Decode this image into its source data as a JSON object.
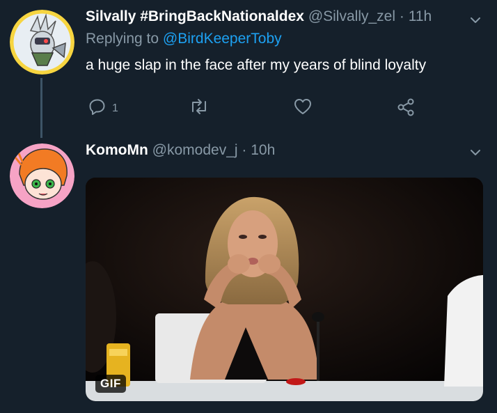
{
  "tweet1": {
    "display_name": "Silvally #BringBackNationaldex",
    "handle": "@Silvally_zel",
    "separator": "·",
    "time": "11h",
    "replying_prefix": "Replying to",
    "replying_to": "@BirdKeeperToby",
    "text": "a huge slap in the face after my years of blind loyalty",
    "reply_count": "1",
    "avatar_bg": "#f7d540"
  },
  "tweet2": {
    "display_name": "KomoMn",
    "handle": "@komodev_j",
    "separator": "·",
    "time": "10h",
    "avatar_bg": "#f6a3c5",
    "media_badge": "GIF"
  },
  "colors": {
    "background": "#15202b",
    "secondary_text": "#8899a6",
    "link": "#1da1f2",
    "thread_line": "#3d5466"
  },
  "icons": [
    "reply-icon",
    "retweet-icon",
    "like-icon",
    "share-icon",
    "chevron-down-icon"
  ]
}
